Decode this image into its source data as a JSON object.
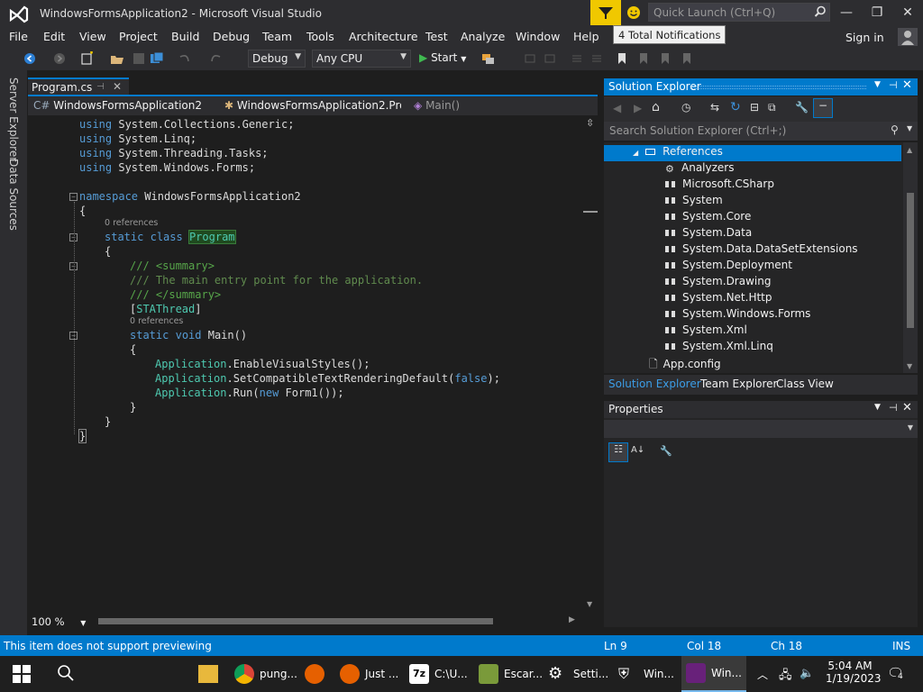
{
  "title_bar": {
    "window_title": "WindowsFormsApplication2 - Microsoft Visual Studio",
    "quick_launch_placeholder": "Quick Launch (Ctrl+Q)",
    "tooltip": "4 Total Notifications"
  },
  "menu": [
    "File",
    "Edit",
    "View",
    "Project",
    "Build",
    "Debug",
    "Team",
    "Tools",
    "Architecture",
    "Test",
    "Analyze",
    "Window",
    "Help"
  ],
  "signin": "Sign in",
  "toolbar": {
    "config": "Debug",
    "platform": "Any CPU",
    "start": "Start"
  },
  "left_tabs": [
    "Server Explorer",
    "Data Sources"
  ],
  "document_tab": "Program.cs",
  "nav": {
    "project": "WindowsFormsApplication2",
    "class": "WindowsFormsApplication2.Program",
    "member": "Main()"
  },
  "code": {
    "usings": [
      "System.Collections.Generic;",
      "System.Linq;",
      "System.Threading.Tasks;",
      "System.Windows.Forms;"
    ],
    "namespace": "WindowsFormsApplication2",
    "references_label": "0 references",
    "class_name": "Program",
    "summary_open": "/// <summary>",
    "summary_text": "/// The main entry point for the application.",
    "summary_close": "/// </summary>",
    "attribute": "STAThread",
    "method": "Main()",
    "call1": "EnableVisualStyles();",
    "call2a": "SetCompatibleTextRenderingDefault(",
    "call2b": "false",
    "call2c": ");",
    "call3a": "Run(",
    "call3b": "new",
    "call3c": " Form1());"
  },
  "zoom": "100 %",
  "solution_explorer": {
    "title": "Solution Explorer",
    "search_placeholder": "Search Solution Explorer (Ctrl+;)",
    "tree": [
      {
        "label": "References",
        "level": 0,
        "selected": true
      },
      {
        "label": "Analyzers",
        "level": 1
      },
      {
        "label": "Microsoft.CSharp",
        "level": 1
      },
      {
        "label": "System",
        "level": 1
      },
      {
        "label": "System.Core",
        "level": 1
      },
      {
        "label": "System.Data",
        "level": 1
      },
      {
        "label": "System.Data.DataSetExtensions",
        "level": 1
      },
      {
        "label": "System.Deployment",
        "level": 1
      },
      {
        "label": "System.Drawing",
        "level": 1
      },
      {
        "label": "System.Net.Http",
        "level": 1
      },
      {
        "label": "System.Windows.Forms",
        "level": 1
      },
      {
        "label": "System.Xml",
        "level": 1
      },
      {
        "label": "System.Xml.Linq",
        "level": 1
      },
      {
        "label": "App.config",
        "level": 0
      }
    ],
    "tabs": [
      "Solution Explorer",
      "Team Explorer",
      "Class View"
    ]
  },
  "properties": {
    "title": "Properties"
  },
  "status": {
    "message": "This item does not support previewing",
    "ln": "Ln 9",
    "col": "Col 18",
    "ch": "Ch 18",
    "mode": "INS"
  },
  "taskbar": {
    "apps": [
      "pung...",
      "Just ...",
      "C:\\U...",
      "Escar...",
      "Setti...",
      "Win...",
      "Win..."
    ],
    "time": "5:04 AM",
    "date": "1/19/2023",
    "notifications": "4"
  },
  "colors": {
    "accent": "#007acc",
    "notification": "#f0c800",
    "vs_purple": "#68217a"
  }
}
